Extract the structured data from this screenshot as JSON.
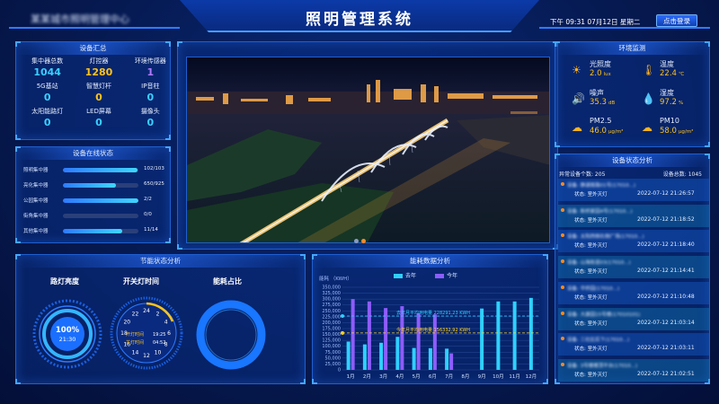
{
  "header": {
    "title": "照明管理系统",
    "org_name": "某某城市照明管理中心",
    "datetime": "下午 09:31 07月12日 星期二",
    "login_label": "点击登录"
  },
  "device_summary": {
    "title": "设备汇总",
    "items": [
      {
        "label": "集中器总数",
        "value": "1044"
      },
      {
        "label": "灯控器",
        "value": "1280"
      },
      {
        "label": "环境传感器",
        "value": "1"
      },
      {
        "label": "5G基站",
        "value": "0"
      },
      {
        "label": "智慧灯杆",
        "value": "0"
      },
      {
        "label": "IP音柱",
        "value": "0"
      },
      {
        "label": "太阳能路灯",
        "value": "0"
      },
      {
        "label": "LED屏幕",
        "value": "0"
      },
      {
        "label": "摄像头",
        "value": "0"
      }
    ],
    "value_colors": [
      "#3ad0ff",
      "#ffc31a",
      "#b07bff",
      "#3ad0ff",
      "#ffc31a",
      "#3ad0ff",
      "#3ad0ff",
      "#3ad0ff",
      "#3ad0ff"
    ]
  },
  "online_status": {
    "title": "设备在线状态",
    "rows": [
      {
        "label": "照明集中器",
        "value": "102/103",
        "fraction": 0.99
      },
      {
        "label": "亮化集中器",
        "value": "650/925",
        "fraction": 0.7
      },
      {
        "label": "公园集中器",
        "value": "2/2",
        "fraction": 1.0
      },
      {
        "label": "街角集中器",
        "value": "0/0",
        "fraction": 0.0
      },
      {
        "label": "其他集中器",
        "value": "11/14",
        "fraction": 0.79
      }
    ]
  },
  "video": {
    "active_dot": 1
  },
  "environment": {
    "title": "环境监测",
    "items": [
      {
        "icon": "sun-icon",
        "glyph": "☀",
        "label": "光照度",
        "value": "2.0",
        "unit": "lux"
      },
      {
        "icon": "thermometer-icon",
        "glyph": "🌡",
        "label": "温度",
        "value": "22.4",
        "unit": "℃"
      },
      {
        "icon": "speaker-icon",
        "glyph": "🔊",
        "label": "噪声",
        "value": "35.3",
        "unit": "dB"
      },
      {
        "icon": "droplet-icon",
        "glyph": "💧",
        "label": "湿度",
        "value": "97.2",
        "unit": "%"
      },
      {
        "icon": "particle-icon",
        "glyph": "☁",
        "label": "PM2.5",
        "value": "46.0",
        "unit": "μg/m³"
      },
      {
        "icon": "particle-icon",
        "glyph": "☁",
        "label": "PM10",
        "value": "58.0",
        "unit": "μg/m³"
      }
    ]
  },
  "status_analysis": {
    "title": "设备状态分析",
    "abnormal_label": "异常设备个数: 205",
    "total_label": "设备总数: 1045",
    "items": [
      {
        "name": "设备: 静湖南路01号(17010...)",
        "state": "状态: 室外灭灯",
        "time": "2022-07-12 21:26:57"
      },
      {
        "name": "设备: 新桥家园4号(17010...)",
        "state": "状态: 室外灭灯",
        "time": "2022-07-12 21:18:52"
      },
      {
        "name": "设备: 太阳西侧右侧广场(17010...)",
        "state": "状态: 室外灭灯",
        "time": "2022-07-12 21:18:40"
      },
      {
        "name": "设备: 山海街道03(17010...)",
        "state": "状态: 室外灭灯",
        "time": "2022-07-12 21:14:41"
      },
      {
        "name": "设备: 华侨园(17010...)",
        "state": "状态: 室外灭灯",
        "time": "2022-07-12 21:10:48"
      },
      {
        "name": "设备: 大康园15号楼(17010101)",
        "state": "状态: 室外灭灯",
        "time": "2022-07-12 21:03:14"
      },
      {
        "name": "设备: 三社区后下(17010...)",
        "state": "状态: 室外灭灯",
        "time": "2022-07-12 21:03:11"
      },
      {
        "name": "设备: 3号楼楼顶平台(17010...)",
        "state": "状态: 室外灭灯",
        "time": "2022-07-12 21:02:51"
      }
    ]
  },
  "energy_saving": {
    "title": "节能状态分析",
    "brightness_title": "路灯亮度",
    "brightness_value": "100%",
    "brightness_time": "21:30",
    "brightness_fraction": 1.0,
    "switch_title": "开关灯时间",
    "on_label": "开灯时间",
    "on_time": "19:25",
    "off_label": "关灯时间",
    "off_time": "04:52",
    "clock_numbers": [
      "24",
      "2",
      "4",
      "6",
      "8",
      "10",
      "12",
      "14",
      "16",
      "18",
      "20",
      "22"
    ],
    "ratio_title": "能耗占比"
  },
  "chart_data": {
    "type": "bar",
    "title": "能耗数据分析",
    "ylabel": "能耗 （KWH）",
    "categories": [
      "1月",
      "2月",
      "3月",
      "4月",
      "5月",
      "6月",
      "7月",
      "8月",
      "9月",
      "10月",
      "11月",
      "12月"
    ],
    "series": [
      {
        "name": "去年",
        "color": "#2fd0ff",
        "values": [
          120000,
          108000,
          115000,
          140000,
          93000,
          92000,
          90000,
          0,
          0,
          0,
          0,
          0
        ]
      },
      {
        "name": "今年",
        "color": "#8e5cff",
        "values": [
          300000,
          290000,
          262000,
          270000,
          240000,
          235000,
          70000,
          0,
          0,
          0,
          0,
          0
        ]
      }
    ],
    "extra_bars": [
      {
        "category": "9月",
        "value": 260000
      },
      {
        "category": "10月",
        "value": 290000
      },
      {
        "category": "11月",
        "value": 290000
      },
      {
        "category": "12月",
        "value": 305000
      }
    ],
    "extra_color": "#2fd0ff",
    "annotations": [
      {
        "text": "去年月平均用电量 228291.23 KWH",
        "y": 228291.23,
        "color": "#2fd0ff"
      },
      {
        "text": "今年月平均用电量 156332.92 KWH",
        "y": 156332.92,
        "color": "#ffd21f"
      }
    ],
    "ylim": [
      0,
      350000
    ],
    "yticks": [
      "0",
      "25,000",
      "50,000",
      "75,000",
      "100,000",
      "125,000",
      "150,000",
      "175,000",
      "200,000",
      "225,000",
      "250,000",
      "275,000",
      "300,000",
      "325,000",
      "350,000"
    ],
    "grid": true,
    "legend": "top-center"
  }
}
